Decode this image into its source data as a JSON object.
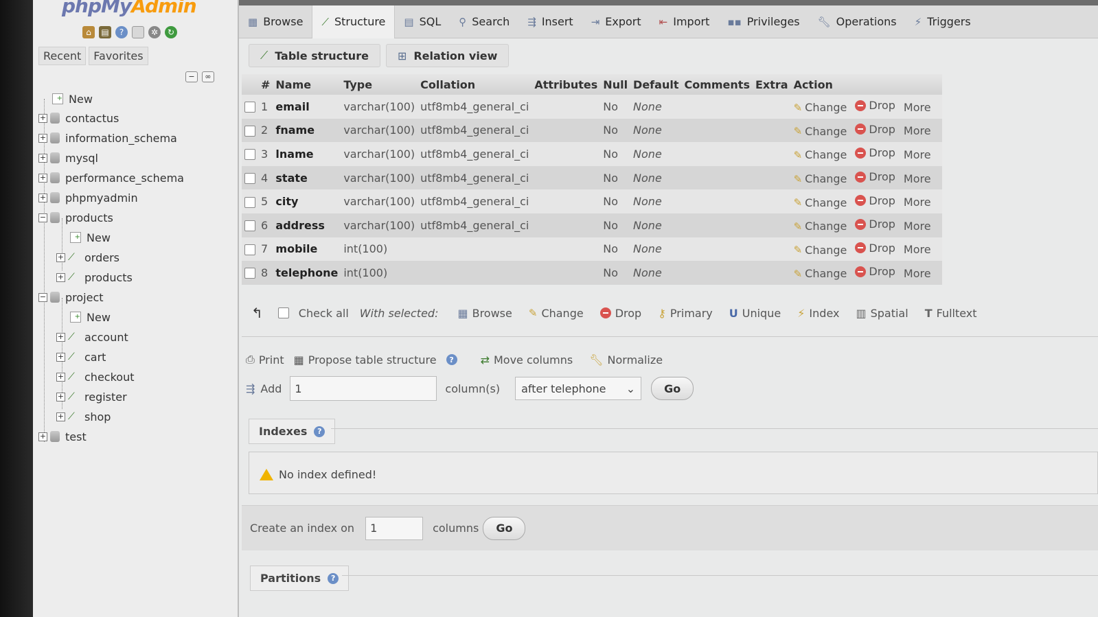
{
  "sidebar": {
    "logo_php": "php",
    "logo_my": "My",
    "logo_admin": "Admin",
    "tabs": [
      "Recent",
      "Favorites"
    ],
    "tree": [
      {
        "label": "New"
      },
      {
        "label": "contactus"
      },
      {
        "label": "information_schema"
      },
      {
        "label": "mysql"
      },
      {
        "label": "performance_schema"
      },
      {
        "label": "phpmyadmin"
      },
      {
        "label": "products"
      },
      {
        "label": "New"
      },
      {
        "label": "orders"
      },
      {
        "label": "products"
      },
      {
        "label": "project"
      },
      {
        "label": "New"
      },
      {
        "label": "account"
      },
      {
        "label": "cart"
      },
      {
        "label": "checkout"
      },
      {
        "label": "register"
      },
      {
        "label": "shop"
      },
      {
        "label": "test"
      }
    ]
  },
  "tabs": [
    "Browse",
    "Structure",
    "SQL",
    "Search",
    "Insert",
    "Export",
    "Import",
    "Privileges",
    "Operations",
    "Triggers"
  ],
  "subtabs": [
    "Table structure",
    "Relation view"
  ],
  "table": {
    "headers": [
      "#",
      "Name",
      "Type",
      "Collation",
      "Attributes",
      "Null",
      "Default",
      "Comments",
      "Extra",
      "Action"
    ],
    "rows": [
      {
        "num": "1",
        "name": "email",
        "type": "varchar(100)",
        "collation": "utf8mb4_general_ci",
        "null": "No",
        "default": "None"
      },
      {
        "num": "2",
        "name": "fname",
        "type": "varchar(100)",
        "collation": "utf8mb4_general_ci",
        "null": "No",
        "default": "None"
      },
      {
        "num": "3",
        "name": "lname",
        "type": "varchar(100)",
        "collation": "utf8mb4_general_ci",
        "null": "No",
        "default": "None"
      },
      {
        "num": "4",
        "name": "state",
        "type": "varchar(100)",
        "collation": "utf8mb4_general_ci",
        "null": "No",
        "default": "None"
      },
      {
        "num": "5",
        "name": "city",
        "type": "varchar(100)",
        "collation": "utf8mb4_general_ci",
        "null": "No",
        "default": "None"
      },
      {
        "num": "6",
        "name": "address",
        "type": "varchar(100)",
        "collation": "utf8mb4_general_ci",
        "null": "No",
        "default": "None"
      },
      {
        "num": "7",
        "name": "mobile",
        "type": "int(100)",
        "collation": "",
        "null": "No",
        "default": "None"
      },
      {
        "num": "8",
        "name": "telephone",
        "type": "int(100)",
        "collation": "",
        "null": "No",
        "default": "None"
      }
    ],
    "actions": {
      "change": "Change",
      "drop": "Drop",
      "more": "More"
    }
  },
  "with_selected": {
    "check_all": "Check all",
    "label": "With selected:",
    "items": [
      "Browse",
      "Change",
      "Drop",
      "Primary",
      "Unique",
      "Index",
      "Spatial",
      "Fulltext"
    ]
  },
  "tools": {
    "print": "Print",
    "propose": "Propose table structure",
    "move": "Move columns",
    "normalize": "Normalize"
  },
  "add": {
    "label": "Add",
    "value": "1",
    "columns_label": "column(s)",
    "position": "after telephone",
    "go": "Go"
  },
  "indexes": {
    "legend": "Indexes",
    "message": "No index defined!",
    "create_label": "Create an index on",
    "create_value": "1",
    "columns_label": "columns",
    "go": "Go"
  },
  "partitions": {
    "legend": "Partitions"
  }
}
